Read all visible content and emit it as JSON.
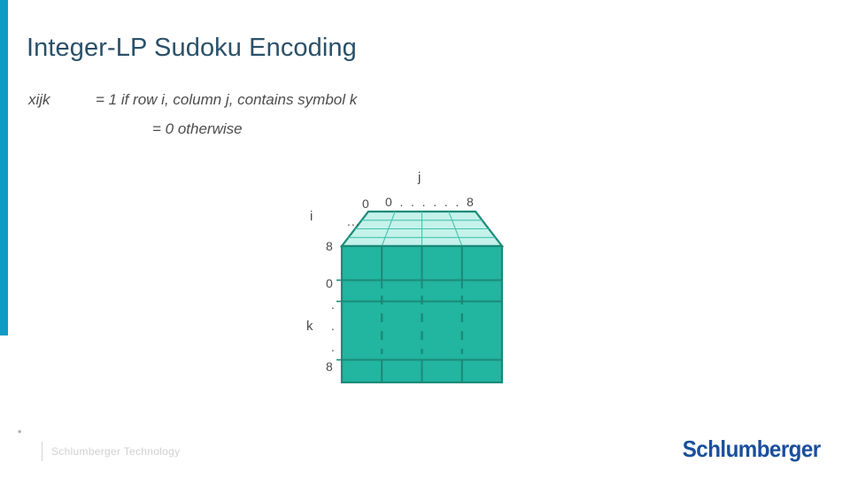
{
  "slide": {
    "title": "Integer-LP Sudoku Encoding",
    "accent_color": "#0f9bc4",
    "title_color": "#2a5069"
  },
  "definition": {
    "variable": "xijk",
    "line1": "= 1 if row i, column j, contains symbol k",
    "line2": "= 0 otherwise"
  },
  "diagram": {
    "type": "3d-grid-cube",
    "top_face_color": "#c5f2ea",
    "front_face_color": "#22b5a0",
    "edge_color": "#1a8a78",
    "axes": {
      "j": {
        "label": "j",
        "ticks": "0 . . . . . . 8",
        "start": "0",
        "end": "8"
      },
      "i": {
        "label": "i",
        "tick_start": "0",
        "tick_dots": "...",
        "tick_end": "8"
      },
      "k": {
        "label": "k",
        "tick_start": "0",
        "dot1": ".",
        "dot2": ".",
        "dot3": ".",
        "tick_end": "8"
      }
    }
  },
  "footer": {
    "page_number": "*",
    "text": "Schlumberger Technology",
    "brand": "Schlumberger",
    "brand_color": "#1a4f9c"
  }
}
